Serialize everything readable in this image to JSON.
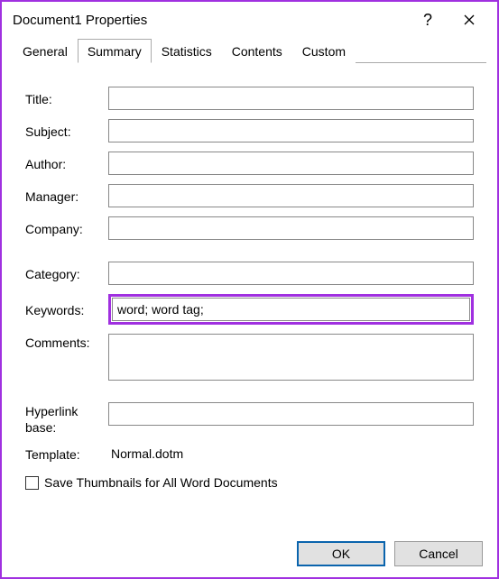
{
  "window": {
    "title": "Document1 Properties"
  },
  "tabs": {
    "general": "General",
    "summary": "Summary",
    "statistics": "Statistics",
    "contents": "Contents",
    "custom": "Custom"
  },
  "labels": {
    "title": "Title:",
    "subject": "Subject:",
    "author": "Author:",
    "manager": "Manager:",
    "company": "Company:",
    "category": "Category:",
    "keywords": "Keywords:",
    "comments": "Comments:",
    "hyperlink_base": "Hyperlink base:",
    "template": "Template:"
  },
  "values": {
    "title": "",
    "subject": "",
    "author": "",
    "manager": "",
    "company": "",
    "category": "",
    "keywords": "word; word tag;",
    "comments": "",
    "hyperlink_base": "",
    "template": "Normal.dotm"
  },
  "checkbox": {
    "save_thumbnails": "Save Thumbnails for All Word Documents",
    "checked": false
  },
  "buttons": {
    "ok": "OK",
    "cancel": "Cancel"
  }
}
